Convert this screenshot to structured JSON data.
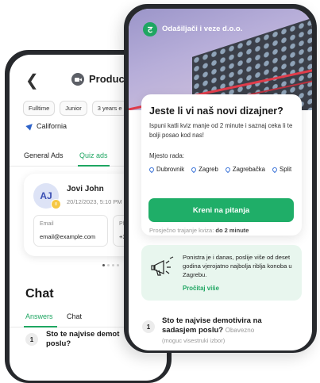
{
  "back_phone": {
    "header": {
      "title": "Product D"
    },
    "chips": [
      "Fulltime",
      "Junior",
      "3 years e"
    ],
    "location": "California",
    "tabs": [
      "General Ads",
      "Quiz ads"
    ],
    "profile": {
      "initials": "AJ",
      "badge": "8",
      "name": "Jovi John",
      "date": "20/12/2023, 5:10 PM",
      "email_label": "Email",
      "email_value": "email@example.com",
      "phone_label": "Pho",
      "phone_value": "+3"
    },
    "chat": {
      "title": "Chat",
      "tabs": [
        "Answers",
        "Chat"
      ],
      "question_number": "1",
      "question_line1": "Sto te najvise demot",
      "question_line2": "poslu?"
    }
  },
  "front_phone": {
    "company": "Odašiljači i veze d.o.o.",
    "logo_glyph": "ट",
    "quiz": {
      "title": "Jeste li vi naš novi dizajner?",
      "description": "Ispuni katli kviz manje od 2 minute i saznaj ceka li te bolji posao kod nas!",
      "location_label": "Mjesto rada:",
      "cities": [
        "Dubrovnik",
        "Zagreb",
        "Zagrebačka",
        "Split"
      ],
      "button": "Kreni na pitanja",
      "avg_prefix": "Prosječno trajanje kviza:",
      "avg_value": "do 2 minute"
    },
    "fact": {
      "text": "Ponistra je i danas, poslije više od deset godina vjerojatno najbolja riblja konoba u Zagrebu.",
      "link": "Pročitaj više"
    },
    "question": {
      "number": "1",
      "text": "Sto te najvise demotivira na sadasjem poslu?",
      "meta": "Obavezno",
      "sub": "(moguc visestruki izbor)"
    }
  },
  "colors": {
    "accent": "#1fae68",
    "pin": "#3c74d8",
    "phone_frame": "#27292d"
  }
}
